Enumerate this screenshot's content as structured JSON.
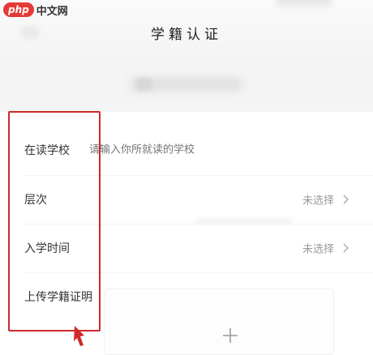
{
  "watermark": {
    "badge": "php",
    "text": "中文网"
  },
  "header": {
    "title": "学籍认证"
  },
  "form": {
    "school": {
      "label": "在读学校",
      "placeholder": "请输入你所就读的学校"
    },
    "level": {
      "label": "层次",
      "value": "未选择"
    },
    "enroll_time": {
      "label": "入学时间",
      "value": "未选择"
    },
    "certificate": {
      "label": "上传学籍证明"
    }
  },
  "colors": {
    "highlight": "#cc2a2a",
    "accent_text": "#333333",
    "muted_text": "#999999"
  },
  "icons": [
    "back-icon",
    "chevron-right-icon",
    "plus-icon",
    "red-arrow-icon"
  ]
}
